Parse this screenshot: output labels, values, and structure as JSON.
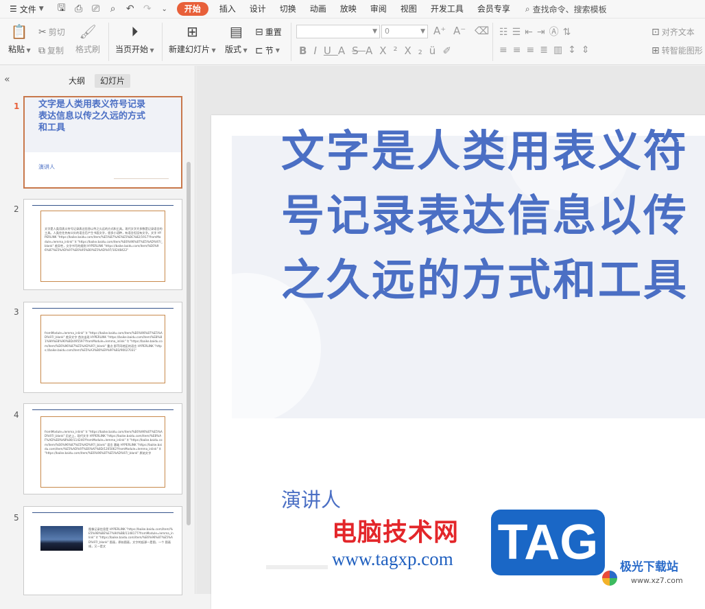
{
  "menu": {
    "file_label": "文件",
    "tabs": [
      {
        "label": "开始",
        "active": true
      },
      {
        "label": "插入"
      },
      {
        "label": "设计"
      },
      {
        "label": "切换"
      },
      {
        "label": "动画"
      },
      {
        "label": "放映"
      },
      {
        "label": "审阅"
      },
      {
        "label": "视图"
      },
      {
        "label": "开发工具"
      },
      {
        "label": "会员专享"
      }
    ],
    "search_label": "查找命令、搜索模板"
  },
  "ribbon": {
    "paste": "粘贴",
    "cut": "剪切",
    "copy": "复制",
    "format_painter": "格式刷",
    "play_current": "当页开始",
    "new_slide": "新建幻灯片",
    "layout": "版式",
    "section": "节",
    "reset": "重置",
    "font_size_value": "0",
    "align_text": "对齐文本",
    "smart_art": "转智能图形"
  },
  "panel": {
    "tab_outline": "大纲",
    "tab_slides": "幻灯片"
  },
  "slides": [
    {
      "num": "1",
      "title": "文字是人类用表义符号记录表达信息以传之久远的方式和工具",
      "subtitle": "演讲人"
    },
    {
      "num": "2",
      "text": "文字是人类用表义符号记录表达信息以传之久远的方式和工具。现代文字大多数是记录语言的工具。人类往往先有口头的语言后产生书面文字，很多小语种，有语言但没有文字。文字 HYPERLINK \"https://baike.baidu.com/item/%E5%B7%AE%E5%BC%82/1917?fromModule=lemma_inlink\" \\t \"https://baike.baidu.com/item/%E6%96%87%E5%AD%97/_blank\" 差异性，文字书写的规则 HYPERLINK \"https://baike.baidu.com/item/%E6%96%87%E5%AD%97%E6%95%B0%E5%AD%97/10248422\""
    },
    {
      "num": "3",
      "text": "fromModule=lemma_inlink\" \\t \"https://baike.baidu.com/item/%E6%96%87%E5%AD%97/_blank\" 差异文字 首次出现 HYPERLINK \"https://baike.baidu.com/item/%E8%81%9A%E8%90%BD/495597?fromModule=lemma_inlink\" \\t \"https://baike.baidu.com/item/%E6%96%87%E5%AD%97/_blank\" 重点 即不同地区的语言 HYPERLINK \"https://baike.baidu.com/item/%E5%A3%B0%E9%9F%B3/90027031\""
    },
    {
      "num": "4",
      "text": "fromModule=lemma_inlink\" \\t \"https://baike.baidu.com/item/%E6%96%87%E5%AD%97/_blank\" 历史上，现代文字 HYPERLINK \"https://baike.baidu.com/item/%E8%AF%AD%E8%A8%80/114240?fromModule=lemma_inlink\" \\t \"https://baike.baidu.com/item/%E6%96%87%E5%AD%97/_blank\" 语言 基础 HYPERLINK \"https://baike.baidu.com/item/%E5%AD%97%E6%AF%8D/1205062?fromModule=lemma_inlink\" \\t \"https://baike.baidu.com/item/%E6%96%87%E5%AD%97/_blank\" 原始文字"
    },
    {
      "num": "5",
      "text": "图像记录信息是 HYPERLINK \"https://baike.baidu.com/item/%E5%9B%BE%E7%94%BB/1148177?fromModule=lemma_inlink\" \\t \"https://baike.baidu.com/item/%E6%96%87%E5%AD%97/_blank\" 图画，原始图画，文字的起源一是图，一个 图画线，又一是文"
    }
  ],
  "watermark": {
    "cn": "电脑技术网",
    "url": "www.tagxp.com",
    "tag": "TAG",
    "site": "极光下载站",
    "site_url": "www.xz7.com"
  },
  "colors": {
    "accent": "#e8603a",
    "title_blue": "#4b6fc4",
    "frame_orange": "#c8894b"
  }
}
